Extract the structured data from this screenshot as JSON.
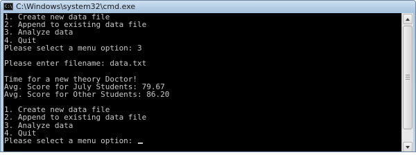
{
  "window": {
    "title": "C:\\Windows\\system32\\cmd.exe",
    "icon_label": "C:\\"
  },
  "console": {
    "lines": [
      "1. Create new data file",
      "2. Append to existing data file",
      "3. Analyze data",
      "4. Quit",
      "Please select a menu option: 3",
      "",
      "Please enter filename: data.txt",
      "",
      "Time for a new theory Doctor!",
      "Avg. Score for July Students: 79.67",
      "Avg. Score for Other Students: 86.20",
      "",
      "1. Create new data file",
      "2. Append to existing data file",
      "3. Analyze data",
      "4. Quit",
      "Please select a menu option: "
    ]
  },
  "icons": {
    "window_icon": "cmd-icon",
    "scroll_up": "arrow-up-icon",
    "scroll_down": "arrow-down-icon"
  },
  "colors": {
    "console_bg": "#000000",
    "console_text": "#c8c8c8",
    "titlebar": "#b5cde6"
  }
}
